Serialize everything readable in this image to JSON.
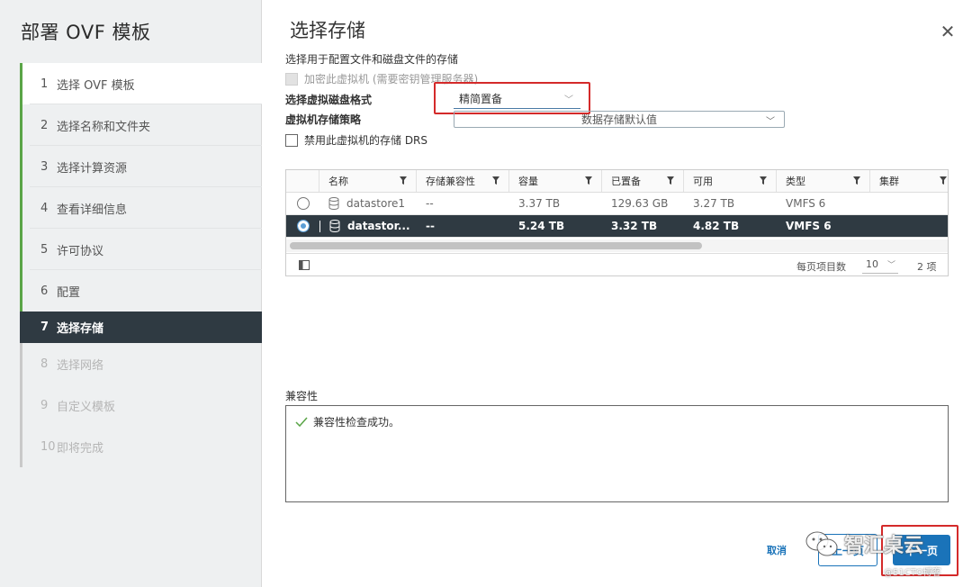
{
  "sidebar": {
    "title": "部署 OVF 模板",
    "steps": [
      {
        "num": "1",
        "label": "选择 OVF 模板"
      },
      {
        "num": "2",
        "label": "选择名称和文件夹"
      },
      {
        "num": "3",
        "label": "选择计算资源"
      },
      {
        "num": "4",
        "label": "查看详细信息"
      },
      {
        "num": "5",
        "label": "许可协议"
      },
      {
        "num": "6",
        "label": "配置"
      },
      {
        "num": "7",
        "label": "选择存储"
      },
      {
        "num": "8",
        "label": "选择网络"
      },
      {
        "num": "9",
        "label": "自定义模板"
      },
      {
        "num": "10",
        "label": "即将完成"
      }
    ]
  },
  "main": {
    "title": "选择存储",
    "subtitle": "选择用于配置文件和磁盘文件的存储",
    "encrypt_label": "加密此虚拟机 (需要密钥管理服务器)",
    "disk_format_label": "选择虚拟磁盘格式",
    "disk_format_value": "精简置备",
    "policy_label": "虚拟机存储策略",
    "policy_value": "数据存储默认值",
    "drs_label": "禁用此虚拟机的存储 DRS"
  },
  "grid": {
    "columns": [
      "名称",
      "存储兼容性",
      "容量",
      "已置备",
      "可用",
      "类型",
      "集群"
    ],
    "rows": [
      {
        "name": "datastore1",
        "compat": "--",
        "capacity": "3.37 TB",
        "provisioned": "129.63 GB",
        "free": "3.27 TB",
        "type": "VMFS 6",
        "cluster": "",
        "selected": false
      },
      {
        "name": "datastor...",
        "compat": "--",
        "capacity": "5.24 TB",
        "provisioned": "3.32 TB",
        "free": "4.82 TB",
        "type": "VMFS 6",
        "cluster": "",
        "selected": true
      }
    ],
    "per_page_label": "每页项目数",
    "per_page_value": "10",
    "item_count": "2 项"
  },
  "compat": {
    "label": "兼容性",
    "message": "兼容性检查成功。"
  },
  "footer": {
    "cancel": "取消",
    "back": "上一页",
    "next": "下一页"
  },
  "watermark": {
    "text": "智汇桌云",
    "small": "@51CTO博客"
  },
  "colors": {
    "accent": "#1a73b9",
    "selected_row": "#2f3a42",
    "completed_step": "#5aa547",
    "highlight_box": "#d42a2a"
  }
}
